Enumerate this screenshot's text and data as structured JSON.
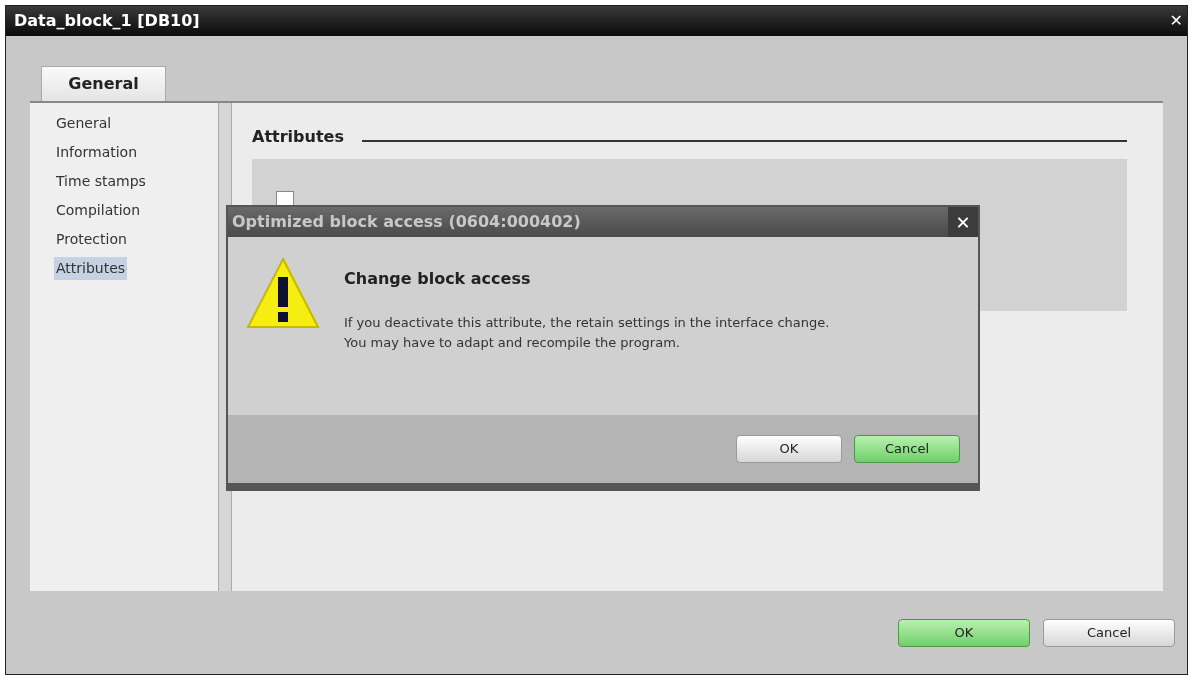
{
  "window": {
    "title": "Data_block_1 [DB10]",
    "close": "✕"
  },
  "tabs": [
    {
      "label": "General",
      "selected": true
    }
  ],
  "sidebar": {
    "items": [
      {
        "label": "General",
        "selected": false
      },
      {
        "label": "Information",
        "selected": false
      },
      {
        "label": "Time stamps",
        "selected": false
      },
      {
        "label": "Compilation",
        "selected": false
      },
      {
        "label": "Protection",
        "selected": false
      },
      {
        "label": "Attributes",
        "selected": true
      }
    ]
  },
  "section": {
    "heading": "Attributes",
    "checkbox": {
      "checked": false
    }
  },
  "buttons": [
    {
      "label": "OK",
      "primary": true
    },
    {
      "label": "Cancel",
      "primary": false
    }
  ],
  "dialog": {
    "title": "Optimized block access (0604:000402)",
    "close": "✕",
    "heading": "Change block access",
    "message": [
      "If you deactivate this attribute, the retain settings in the interface change.",
      "You may have to adapt and recompile the program."
    ],
    "buttons": [
      {
        "label": "OK",
        "primary": false
      },
      {
        "label": "Cancel",
        "primary": true
      }
    ]
  }
}
